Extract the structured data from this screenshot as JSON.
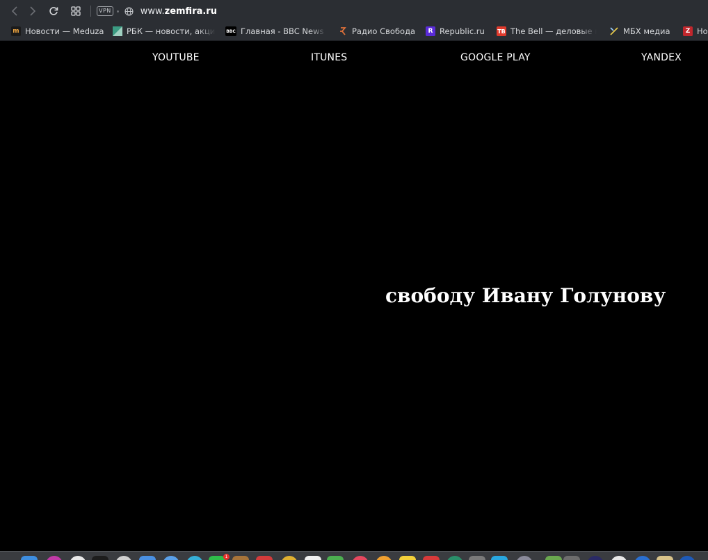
{
  "browser": {
    "vpn_label": "VPN",
    "url_prefix": "www.",
    "url_domain": "zemfira.ru"
  },
  "bookmarks": [
    {
      "label": "Новости — Meduza",
      "icon": "meduza-icon",
      "icon_text": "m",
      "icon_color": "#1b1b1b",
      "icon_fg": "#f0a640"
    },
    {
      "label": "РБК — новости, акции",
      "icon": "rbc-icon",
      "icon_text": "",
      "icon_color": "#3b9b82",
      "icon_fg": "#ffffff"
    },
    {
      "label": "Главная - BBC News Р",
      "icon": "bbc-icon",
      "icon_text": "BBC",
      "icon_color": "#000000",
      "icon_fg": "#ffffff"
    },
    {
      "label": "Радио Свобода",
      "icon": "radio-svoboda-icon",
      "icon_text": "",
      "icon_color": "transparent",
      "icon_fg": "#e0703a"
    },
    {
      "label": "Republic.ru",
      "icon": "republic-icon",
      "icon_text": "R",
      "icon_color": "#5a2bd8",
      "icon_fg": "#ffffff"
    },
    {
      "label": "The Bell — деловые но",
      "icon": "thebell-icon",
      "icon_text": "TB",
      "icon_color": "#e03a2c",
      "icon_fg": "#ffffff"
    },
    {
      "label": "МБХ медиа",
      "icon": "mbh-icon",
      "icon_text": "",
      "icon_color": "transparent",
      "icon_fg": "#e6c84a"
    },
    {
      "label": "Но",
      "icon": "z-icon",
      "icon_text": "Z",
      "icon_color": "#c1272d",
      "icon_fg": "#ffffff"
    }
  ],
  "nav": {
    "youtube": "YOUTUBE",
    "itunes": "ITUNES",
    "google_play": "GOOGLE PLAY",
    "yandex": "YANDEX"
  },
  "slogan": "свободу Ивану Голунову",
  "dock": {
    "badge_count": "1"
  },
  "colors": {
    "toolbar_bg": "#2b2e33",
    "page_bg": "#000000",
    "text_primary": "#ffffff"
  }
}
